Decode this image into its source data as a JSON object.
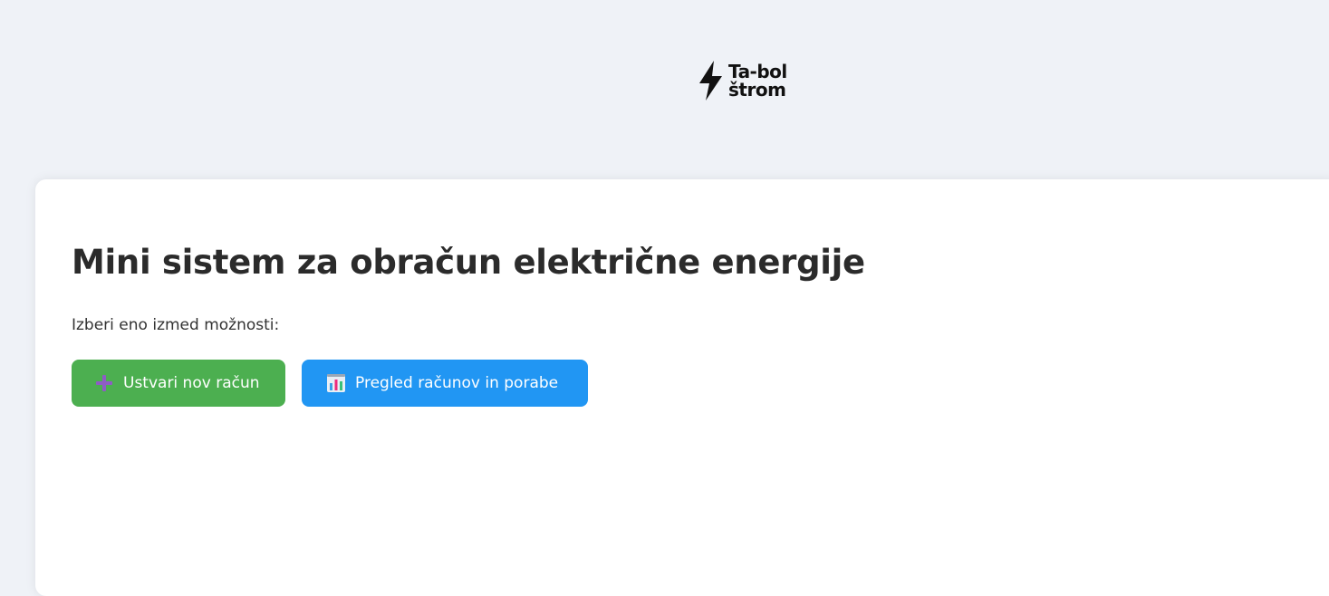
{
  "header": {
    "logo": {
      "line1": "Ta-bol",
      "line2": "štrom",
      "icon": "lightning-bolt-icon"
    }
  },
  "main": {
    "title": "Mini sistem za obračun električne energije",
    "subtitle": "Izberi eno izmed možnosti:",
    "buttons": [
      {
        "label": "Ustvari nov račun",
        "icon": "plus-icon",
        "color": "#4caf50"
      },
      {
        "label": "Pregled računov in porabe",
        "icon": "bar-chart-icon",
        "color": "#2196f3"
      }
    ]
  },
  "colors": {
    "background": "#eff2f7",
    "card": "#ffffff",
    "plus_icon": "#8e5cc4"
  }
}
